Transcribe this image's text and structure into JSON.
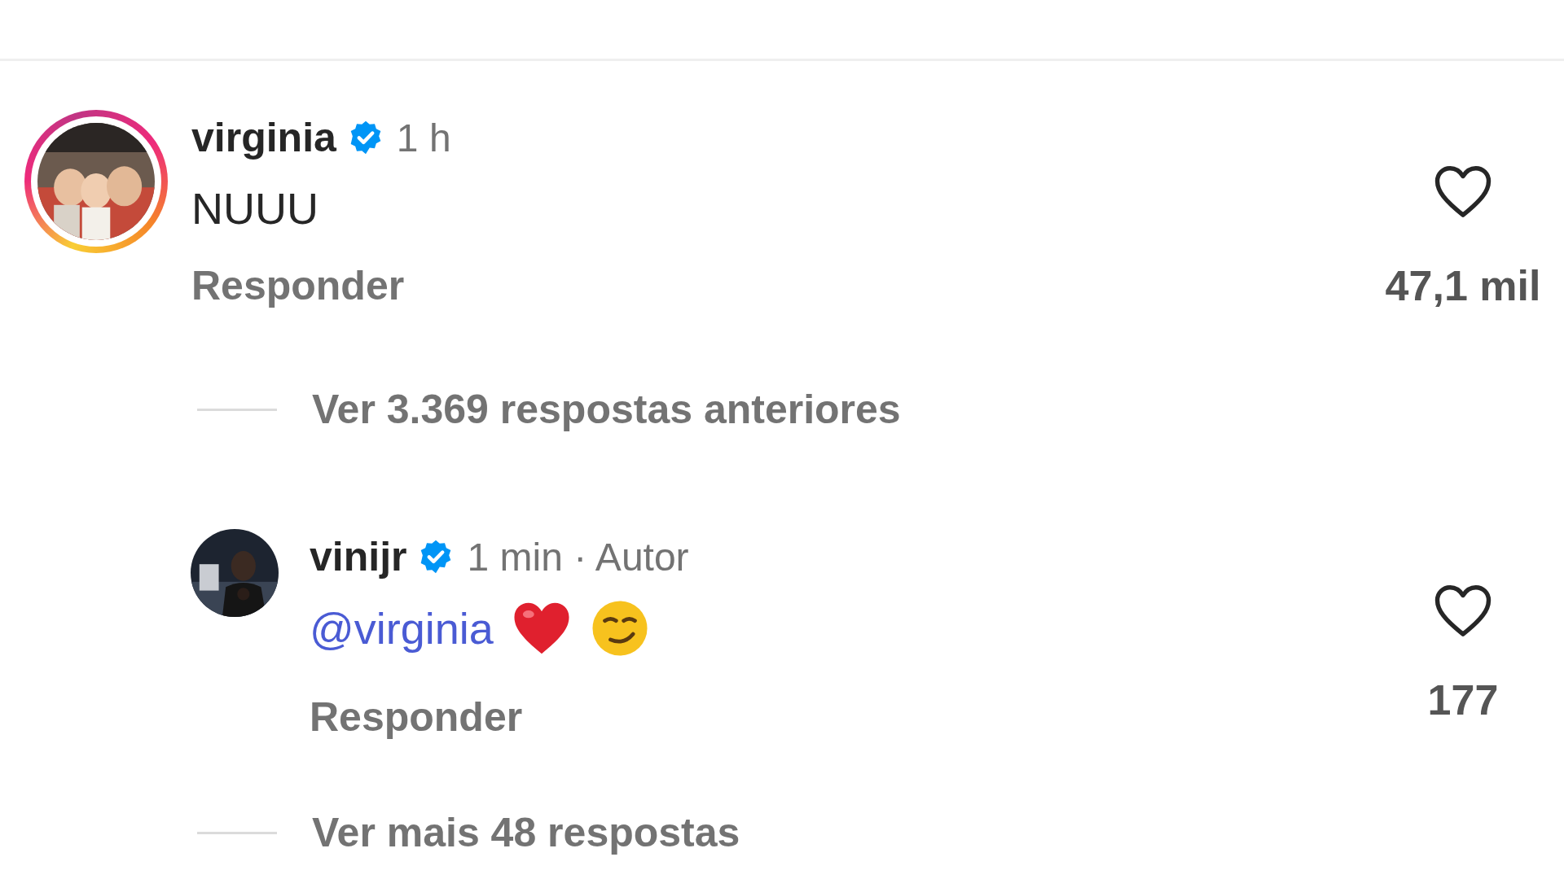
{
  "comments": [
    {
      "username": "virginia",
      "verified": true,
      "time": "1 h",
      "story_ring": true,
      "text": [
        {
          "kind": "text",
          "text": "NUUU"
        }
      ],
      "reply_action": "Responder",
      "liked": false,
      "likes": "47,1 mil",
      "view_replies": "Ver 3.369 respostas anteriores",
      "replies": [
        {
          "username": "vinijr",
          "verified": true,
          "time": "1 min · Autor",
          "story_ring": false,
          "text": [
            {
              "kind": "mention",
              "text": "@virginia"
            },
            {
              "kind": "heart-emoji"
            },
            {
              "kind": "smirk-emoji"
            }
          ],
          "reply_action": "Responder",
          "liked": false,
          "likes": "177"
        }
      ],
      "more_replies": "Ver mais 48 respostas"
    }
  ]
}
